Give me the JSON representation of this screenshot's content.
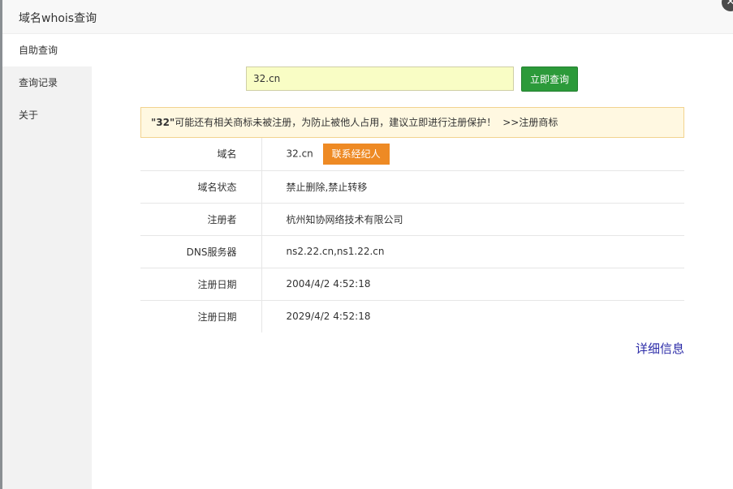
{
  "dialog": {
    "title": "域名whois查询",
    "close_icon": "close-icon"
  },
  "sidebar": {
    "items": [
      {
        "label": "自助查询",
        "active": true
      },
      {
        "label": "查询记录",
        "active": false
      },
      {
        "label": "关于",
        "active": false
      }
    ]
  },
  "search": {
    "value": "32.cn",
    "button_label": "立即查询"
  },
  "notice": {
    "domain": "\"32\"",
    "message": "可能还有相关商标未被注册，为防止被他人占用，建议立即进行注册保护！",
    "link": ">>注册商标"
  },
  "whois": {
    "rows": [
      {
        "label": "域名",
        "value": "32.cn",
        "action": "联系经纪人"
      },
      {
        "label": "域名状态",
        "value": "禁止删除,禁止转移"
      },
      {
        "label": "注册者",
        "value": "杭州知协网络技术有限公司"
      },
      {
        "label": "DNS服务器",
        "value": "ns2.22.cn,ns1.22.cn"
      },
      {
        "label": "注册日期",
        "value": "2004/4/2 4:52:18"
      },
      {
        "label": "注册日期",
        "value": "2029/4/2 4:52:18"
      }
    ]
  },
  "detail_link": "详细信息",
  "colors": {
    "search_bg": "#f9fdc5",
    "search_button": "#2c9a3a",
    "agent_button": "#ee8a24",
    "notice_bg": "#fff8e1",
    "link": "#2c2ca8"
  }
}
